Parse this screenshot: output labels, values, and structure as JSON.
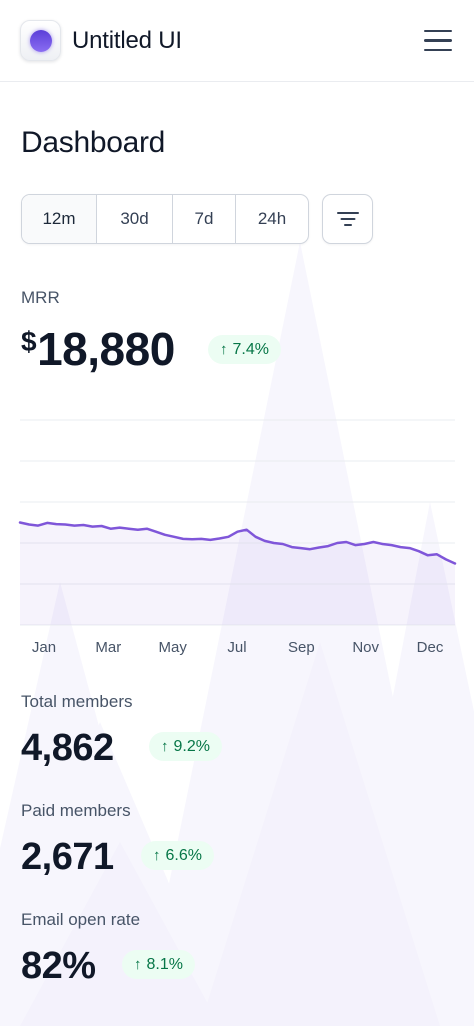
{
  "header": {
    "brand": "Untitled UI",
    "logo_icon": "purple-circle-logo",
    "menu_icon": "hamburger-menu-icon"
  },
  "page": {
    "title": "Dashboard"
  },
  "range_tabs": [
    {
      "label": "12m",
      "active": true
    },
    {
      "label": "30d",
      "active": false
    },
    {
      "label": "7d",
      "active": false
    },
    {
      "label": "24h",
      "active": false
    }
  ],
  "filter_icon": "filter-lines-icon",
  "mrr": {
    "label": "MRR",
    "currency": "$",
    "value": "18,880",
    "change": "7.4%"
  },
  "metrics": [
    {
      "label": "Total members",
      "value": "4,862",
      "change": "9.2%"
    },
    {
      "label": "Paid members",
      "value": "2,671",
      "change": "6.6%"
    },
    {
      "label": "Email open rate",
      "value": "82%",
      "change": "8.1%"
    }
  ],
  "colors": {
    "accent": "#7f56d9",
    "success_bg": "#ecfdf3",
    "success_text": "#067647",
    "grid": "#eaecf0"
  },
  "chart_data": {
    "type": "area",
    "x_ticks": [
      "Jan",
      "Mar",
      "May",
      "Jul",
      "Sep",
      "Nov",
      "Dec"
    ],
    "series": [
      {
        "values": [
          50.0,
          49.0,
          48.5,
          49.8,
          49.2,
          49.0,
          48.5,
          48.8,
          48.0,
          48.3,
          47.0,
          47.5,
          47.0,
          46.5,
          47.0,
          45.5,
          44.0,
          43.0,
          42.0,
          41.8,
          42.0,
          41.5,
          42.2,
          43.0,
          45.5,
          46.5,
          43.0,
          41.0,
          40.0,
          39.5,
          38.0,
          37.5,
          37.0,
          37.8,
          38.5,
          40.0,
          40.5,
          39.0,
          39.5,
          40.5,
          39.5,
          39.0,
          38.0,
          37.5,
          36.0,
          34.0,
          34.5,
          32.0,
          30.0
        ]
      }
    ],
    "ylim": [
      0,
      100
    ],
    "grid": true
  }
}
